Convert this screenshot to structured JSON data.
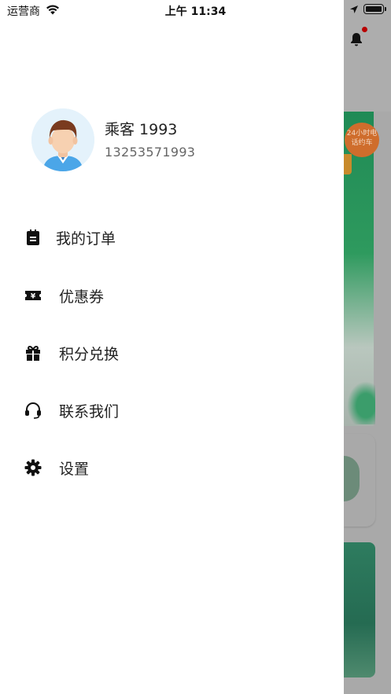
{
  "status_bar": {
    "carrier": "运营商",
    "time": "上午 11:34"
  },
  "background": {
    "badge_text": "24小时电话约车"
  },
  "profile": {
    "name": "乘客 1993",
    "phone": "13253571993"
  },
  "menu": [
    {
      "label": "我的订单",
      "icon": "clipboard-icon"
    },
    {
      "label": "优惠券",
      "icon": "coupon-icon"
    },
    {
      "label": "积分兑换",
      "icon": "gift-icon"
    },
    {
      "label": "联系我们",
      "icon": "headset-icon"
    },
    {
      "label": "设置",
      "icon": "gear-icon"
    }
  ],
  "colors": {
    "drawer_bg": "#ffffff",
    "icon": "#111111",
    "text": "#222222",
    "subtext": "#666666",
    "overlay": "#a9a9a9"
  }
}
